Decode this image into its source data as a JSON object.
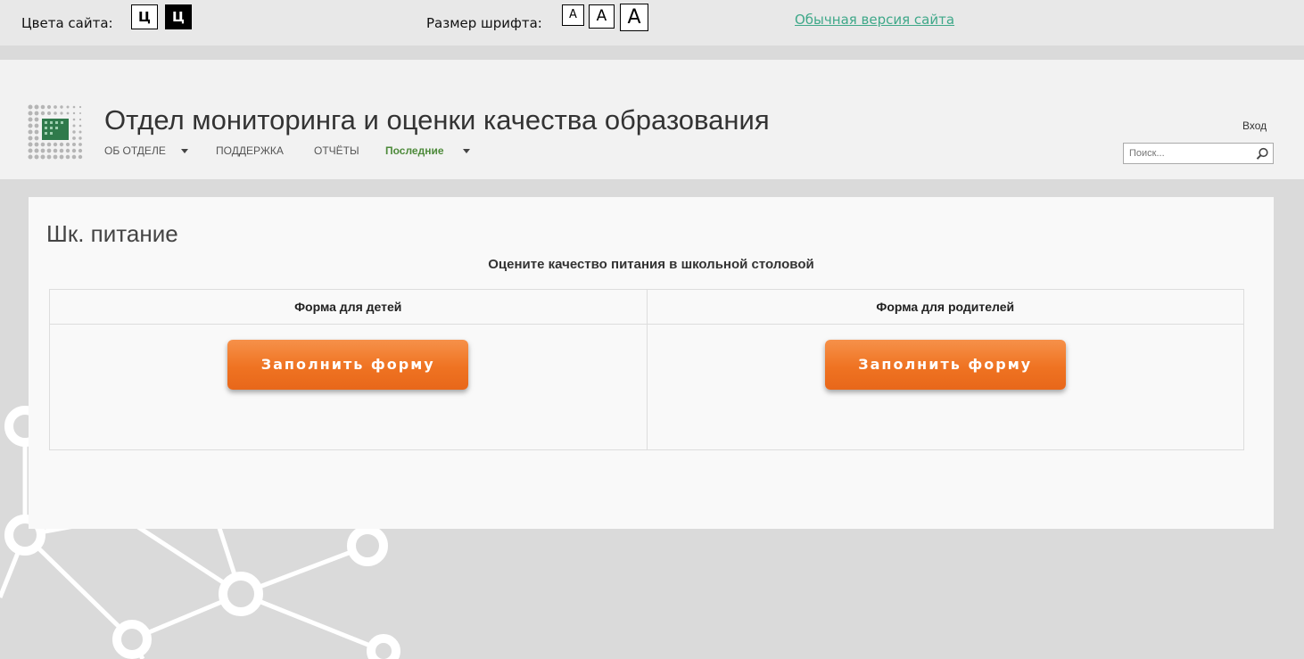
{
  "a11y": {
    "colors_label": "Цвета сайта:",
    "color_white_label": "Ц",
    "color_black_label": "Ц",
    "font_label": "Размер шрифта:",
    "font_small": "А",
    "font_medium": "А",
    "font_large": "А",
    "normal_version": "Обычная версия сайта",
    "link_color": "#3fa889"
  },
  "header": {
    "site_title": "Отдел мониторинга и оценки качества образования",
    "nav": [
      {
        "label": "ОБ ОТДЕЛЕ",
        "has_dropdown": true
      },
      {
        "label": "ПОДДЕРЖКА",
        "has_dropdown": false
      },
      {
        "label": "ОТЧЁТЫ",
        "has_dropdown": false
      },
      {
        "label": "Последние",
        "has_dropdown": true,
        "active": true
      }
    ],
    "login": "Вход",
    "search_placeholder": "Поиск...",
    "active_color": "#4d8a3a"
  },
  "main": {
    "title": "Шк. питание",
    "subtitle": "Оцените качество питания в школьной столовой",
    "forms": [
      {
        "header": "Форма для детей",
        "button": "Заполнить форму"
      },
      {
        "header": "Форма для родителей",
        "button": "Заполнить форму"
      }
    ],
    "button_color": "#ef7322"
  }
}
